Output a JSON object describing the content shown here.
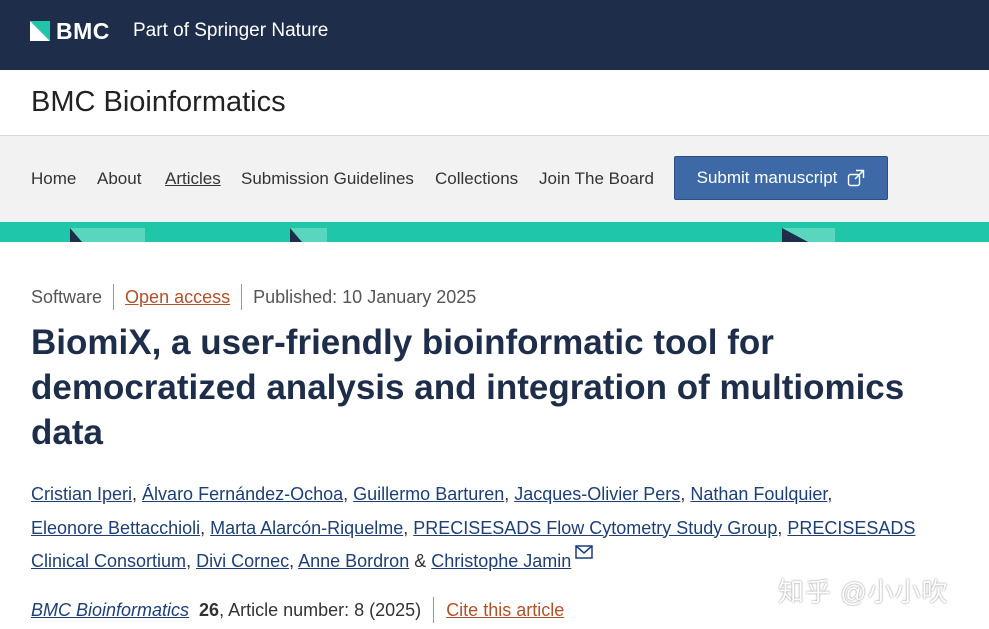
{
  "brand": {
    "logo_text": "BMC",
    "tagline": "Part of Springer Nature"
  },
  "journal": {
    "title": "BMC Bioinformatics"
  },
  "nav": {
    "items": [
      {
        "label": "Home",
        "active": false
      },
      {
        "label": "About",
        "active": false
      },
      {
        "label": "Articles",
        "active": true
      },
      {
        "label": "Submission Guidelines",
        "active": false
      },
      {
        "label": "Collections",
        "active": false
      },
      {
        "label": "Join The Board",
        "active": false
      }
    ],
    "submit_label": "Submit manuscript"
  },
  "article": {
    "type": "Software",
    "access": "Open access",
    "published": "Published: 10 January 2025",
    "title": "BiomiX, a user-friendly bioinformatic tool for democratized analysis and integration of multiomics data",
    "authors": [
      "Cristian Iperi",
      "Álvaro Fernández-Ochoa",
      "Guillermo Barturen",
      "Jacques-Olivier Pers",
      "Nathan Foulquier",
      "Eleonore Bettacchioli",
      "Marta Alarcón-Riquelme",
      "PRECISESADS Flow Cytometry Study Group",
      "PRECISESADS Clinical Consortium",
      "Divi Cornec",
      "Anne Bordron",
      "Christophe Jamin"
    ],
    "author_joiner": "&",
    "citation": {
      "journal": "BMC Bioinformatics",
      "volume": "26",
      "rest": ", Article number: 8 (2025)",
      "cite_label": "Cite this article"
    }
  },
  "watermark": "知乎 @小小吹",
  "colors": {
    "header_bg": "#1e2e4a",
    "logo_teal": "#1fc7a8",
    "button_blue": "#3d6aa6",
    "accent_teal": "#1fc7a8",
    "link_orange": "#b2502a",
    "title_navy": "#1e2e4a"
  }
}
